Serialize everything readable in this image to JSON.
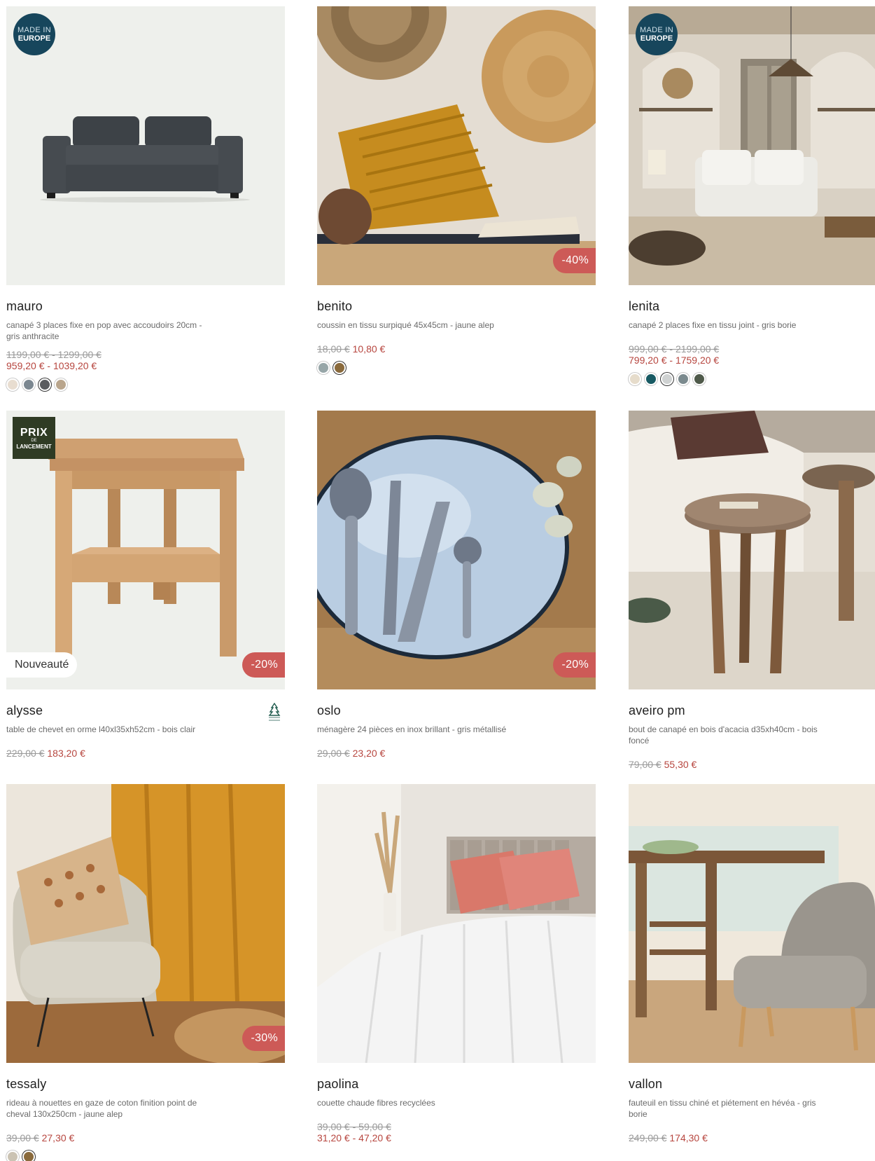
{
  "colors": {
    "sale": "#b7463f",
    "badge_discount": "#cd5a57",
    "badge_europe": "#17465c",
    "badge_prix": "#2f3b24"
  },
  "badges": {
    "europe_line1": "MADE IN",
    "europe_line2": "EUROPE",
    "prix_line1": "PRIX",
    "prix_line2": "DE",
    "prix_line3": "LANCEMENT",
    "new": "Nouveauté"
  },
  "products": [
    {
      "name": "mauro",
      "desc": "canapé 3 places fixe en pop avec accoudoirs 20cm - gris anthracite",
      "old_price": "1199,00 € - 1299,00 €",
      "new_price": "959,20 € - 1039,20 €",
      "image": "grey-sofa-photo",
      "swatches": [
        "#e8ddd0",
        "#7b8790",
        "#5a5c5f",
        "#b9a58c"
      ],
      "selected": 2
    },
    {
      "name": "benito",
      "desc": "coussin en tissu surpiqué 45x45cm - jaune alep",
      "old_price": "18,00 €",
      "new_price": "10,80 €",
      "discount": "-40%",
      "image": "mustard-cushion-photo",
      "swatches": [
        "#97a6a8",
        "#8a6a3c"
      ],
      "selected": 1
    },
    {
      "name": "lenita",
      "desc": "canapé 2 places fixe en tissu joint - gris borie",
      "old_price": "999,00 € - 2199,00 €",
      "new_price": "799,20 € - 1759,20 €",
      "image": "living-room-photo",
      "swatches": [
        "#e6dccb",
        "#185a63",
        "#cfd2d2",
        "#7b8a8e",
        "#4f5a4a"
      ],
      "selected": 2
    },
    {
      "name": "alysse",
      "desc": "table de chevet en orme l40xl35xh52cm - bois clair",
      "old_price": "229,00 €",
      "new_price": "183,20 €",
      "discount": "-20%",
      "image": "wood-bedside-table-photo",
      "label": "fsc-icon"
    },
    {
      "name": "oslo",
      "desc": "ménagère 24 pièces en inox brillant - gris métallisé",
      "old_price": "29,00 €",
      "new_price": "23,20 €",
      "discount": "-20%",
      "image": "cutlery-plate-photo"
    },
    {
      "name": "aveiro pm",
      "desc": "bout de canapé en bois d'acacia d35xh40cm - bois foncé",
      "old_price": "79,00 €",
      "new_price": "55,30 €",
      "image": "side-table-photo"
    },
    {
      "name": "tessaly",
      "desc": "rideau à nouettes en gaze de coton finition point de cheval 130x250cm - jaune alep",
      "old_price": "39,00 €",
      "new_price": "27,30 €",
      "discount": "-30%",
      "image": "curtain-armchair-photo",
      "swatches": [
        "#cbc3b3",
        "#8a6a3c"
      ],
      "selected": 1
    },
    {
      "name": "paolina",
      "desc": "couette chaude fibres recyclées",
      "old_price": "39,00 € - 59,00 €",
      "new_price": "31,20 € - 47,20 €",
      "image": "duvet-bed-photo"
    },
    {
      "name": "vallon",
      "desc": "fauteuil en tissu chiné et piétement en hévéa - gris borie",
      "old_price": "249,00 €",
      "new_price": "174,30 €",
      "image": "grey-armchair-photo"
    }
  ]
}
